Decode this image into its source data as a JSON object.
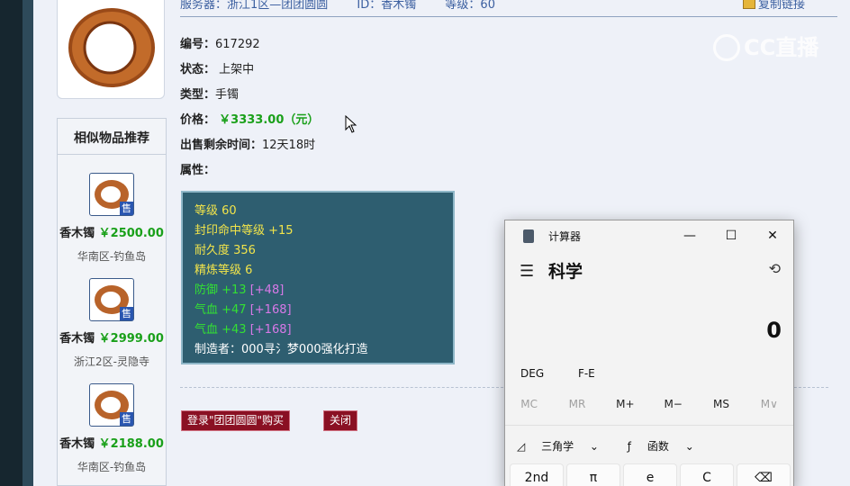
{
  "topbar": {
    "server": "服务器：浙江1区—团团圆圆",
    "id": "ID：香木镯",
    "level": "等级：60",
    "copy_link": "复制链接"
  },
  "watermark": "CC直播",
  "similar": {
    "title": "相似物品推荐",
    "sell_badge": "售",
    "items": [
      {
        "name": "香木镯",
        "price": "￥2500.00",
        "location": "华南区-钓鱼岛"
      },
      {
        "name": "香木镯",
        "price": "￥2999.00",
        "location": "浙江2区-灵隐寺"
      },
      {
        "name": "香木镯",
        "price": "￥2188.00",
        "location": "华南区-钓鱼岛"
      }
    ]
  },
  "detail": {
    "number_label": "编号：",
    "number": "617292",
    "status_label": "状态：",
    "status": "上架中",
    "type_label": "类型：",
    "type": "手镯",
    "price_label": "价格：",
    "price": "￥3333.00（元）",
    "remain_label": "出售剩余时间：",
    "remain": "12天18时",
    "attr_label": "属性："
  },
  "attributes": {
    "level": "等级 60",
    "seal": "封印命中等级 +15",
    "durability": "耐久度 356",
    "refine": "精炼等级 6",
    "defense": "防御 +13",
    "defense_bonus": "[+48]",
    "hp1": "气血 +47",
    "hp1_bonus": "[+168]",
    "hp2": "气血 +43",
    "hp2_bonus": "[+168]",
    "maker": "制造者：000寻氵梦000强化打造"
  },
  "buttons": {
    "buy": "登录\"团团圆圆\"购买",
    "close": "关闭"
  },
  "calculator": {
    "title": "计算器",
    "mode": "科学",
    "display": "0",
    "angle": "DEG",
    "fe": "F-E",
    "memory": [
      "MC",
      "MR",
      "M+",
      "M−",
      "MS",
      "M∨"
    ],
    "trig": "三角学",
    "func": "函数",
    "keys": [
      "2nd",
      "π",
      "e",
      "C",
      "⌫"
    ]
  }
}
